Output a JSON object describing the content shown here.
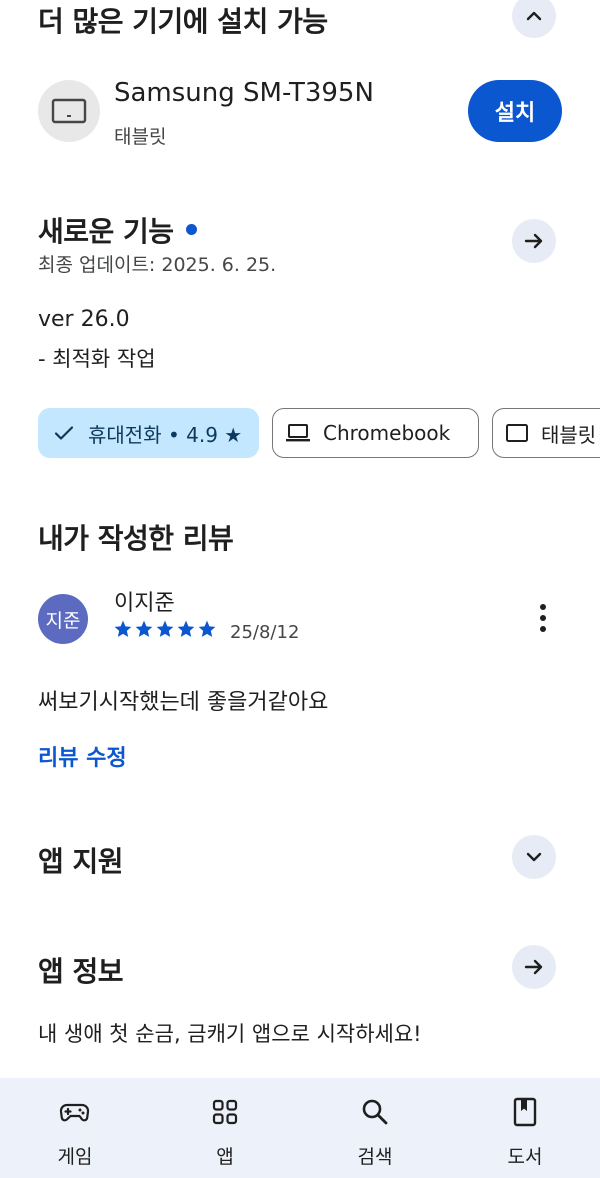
{
  "more_devices": {
    "title": "더 많은 기기에 설치 가능",
    "collapse_icon": "chevron-up-icon",
    "device": {
      "name": "Samsung SM-T395N",
      "type": "태블릿",
      "icon": "tablet-icon",
      "install_label": "설치"
    }
  },
  "whats_new": {
    "title": "새로운 기능",
    "updated": "최종 업데이트: 2025. 6. 25.",
    "version": "ver 26.0",
    "notes": "- 최적화 작업",
    "arrow_icon": "arrow-right-icon"
  },
  "device_chips": [
    {
      "label": "휴대전화 • 4.9 ★",
      "icon": "check-icon",
      "selected": true
    },
    {
      "label": "Chromebook",
      "icon": "laptop-icon",
      "selected": false
    },
    {
      "label": "태블릿",
      "icon": "tablet-icon",
      "selected": false
    }
  ],
  "my_review": {
    "title": "내가 작성한 리뷰",
    "avatar_text": "지준",
    "reviewer": "이지준",
    "rating": 5,
    "date": "25/8/12",
    "text": "써보기시작했는데 좋을거같아요",
    "edit_label": "리뷰 수정"
  },
  "app_support": {
    "title": "앱 지원",
    "icon": "chevron-down-icon"
  },
  "app_info": {
    "title": "앱 정보",
    "description": "내 생애 첫 순금, 금캐기 앱으로 시작하세요!",
    "icon": "arrow-right-icon"
  },
  "bottom_nav": [
    {
      "label": "게임",
      "icon": "gamepad-icon"
    },
    {
      "label": "앱",
      "icon": "apps-grid-icon"
    },
    {
      "label": "검색",
      "icon": "search-icon"
    },
    {
      "label": "도서",
      "icon": "book-icon"
    }
  ],
  "colors": {
    "accent": "#0b57d0",
    "chip_selected": "#c2e7ff",
    "circle_button": "#e6ebf5",
    "avatar": "#5c6bc0",
    "nav_bg": "#edf2fa"
  }
}
